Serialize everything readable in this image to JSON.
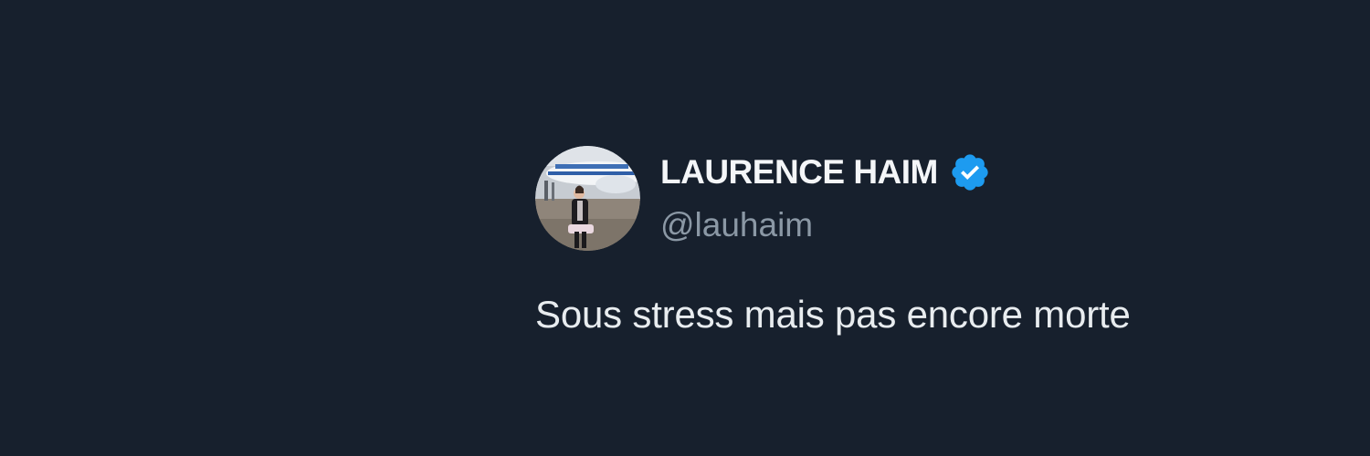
{
  "tweet": {
    "author": {
      "display_name": "LAURENCE HAIM",
      "handle": "@lauhaim",
      "avatar": "profile-photo-icon",
      "verified_badge": "verified-badge-icon"
    },
    "text": "Sous stress mais pas encore morte"
  },
  "colors": {
    "background": "#17202d",
    "name": "#f4f6f8",
    "handle": "#8b98a5",
    "text": "#e8ecef",
    "verified": "#1d9bf0"
  }
}
